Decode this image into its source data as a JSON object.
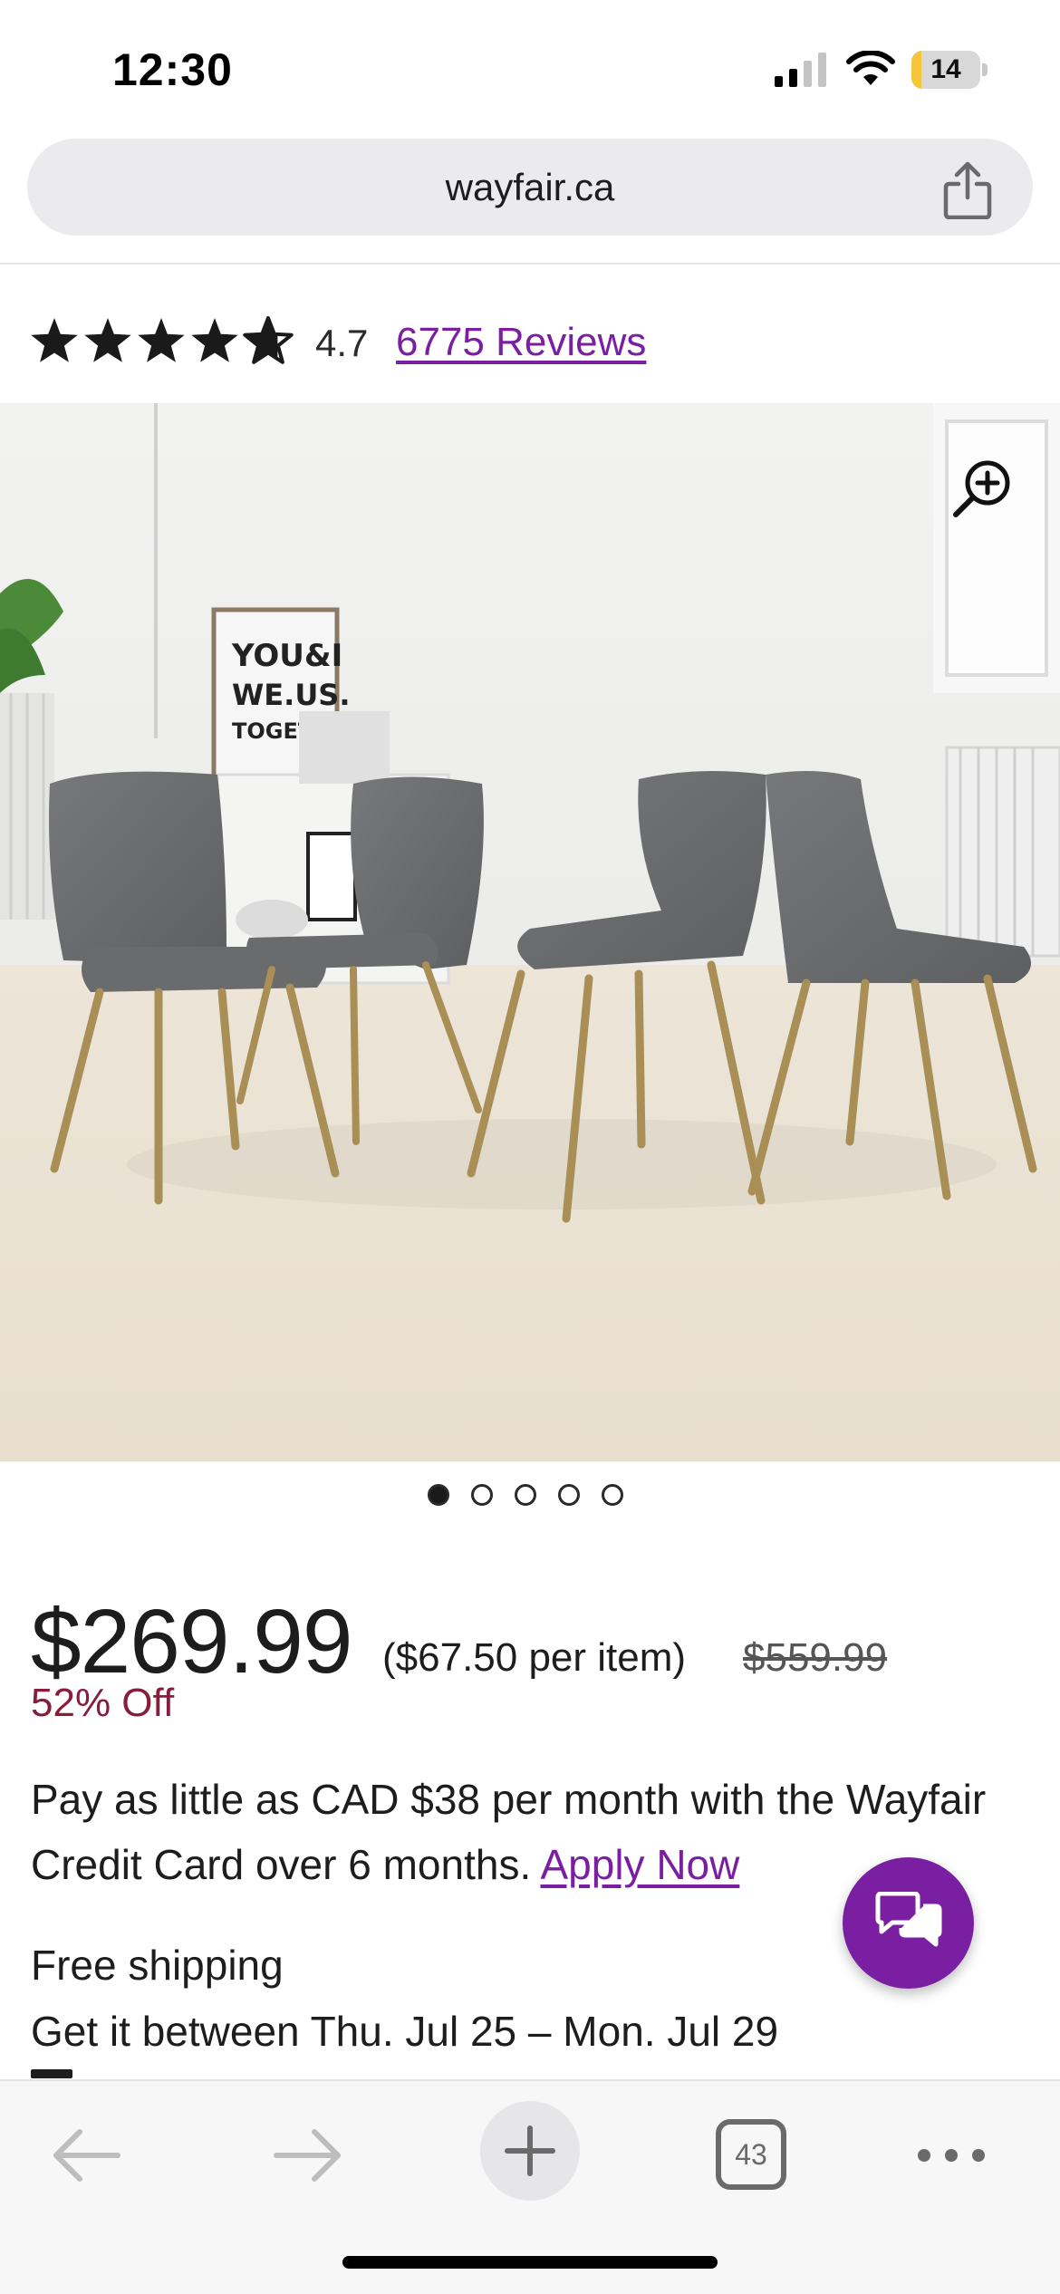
{
  "status_bar": {
    "time": "12:30",
    "battery_level": "14",
    "battery_fraction": 0.14,
    "icons": [
      "signal-icon",
      "wifi-icon",
      "battery-icon"
    ]
  },
  "browser": {
    "url": "wayfair.ca",
    "share_icon": "share-icon",
    "open_tabs": "43"
  },
  "product": {
    "rating": {
      "stars_filled": 4.7,
      "value": "4.7",
      "reviews_label": "6775 Reviews"
    },
    "image": {
      "zoom_icon": "zoom-in-icon",
      "poster_text": [
        "YOU&I",
        "WE.US.",
        "TOGETHER"
      ],
      "carousel_count": 5,
      "carousel_active": 0
    },
    "pricing": {
      "price": "$269.99",
      "per_item": "($67.50 per item)",
      "was_price": "$559.99",
      "discount": "52% Off"
    },
    "financing": {
      "text": "Pay as little as CAD $38 per month with the Wayfair Credit Card over 6 months. ",
      "link": "Apply Now"
    },
    "shipping": {
      "title": "Free shipping",
      "dates": "Get it between Thu. Jul 25 – Mon. Jul 29"
    }
  },
  "chat": {
    "icon": "chat-icon"
  },
  "colors": {
    "brand_purple": "#7b1fa2",
    "link_purple": "#7a1fa2",
    "discount_red": "#8a1c3b",
    "battery_yellow": "#f5c638"
  }
}
